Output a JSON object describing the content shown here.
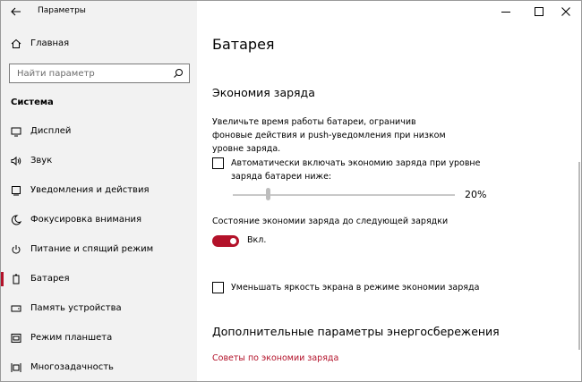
{
  "window": {
    "title": "Параметры"
  },
  "sidebar": {
    "home_label": "Главная",
    "search_placeholder": "Найти параметр",
    "section": "Система",
    "items": [
      {
        "label": "Дисплей",
        "icon": "monitor-icon"
      },
      {
        "label": "Звук",
        "icon": "speaker-icon"
      },
      {
        "label": "Уведомления и действия",
        "icon": "notification-icon"
      },
      {
        "label": "Фокусировка внимания",
        "icon": "moon-icon"
      },
      {
        "label": "Питание и спящий режим",
        "icon": "power-icon"
      },
      {
        "label": "Батарея",
        "icon": "battery-icon",
        "active": true
      },
      {
        "label": "Память устройства",
        "icon": "storage-icon"
      },
      {
        "label": "Режим планшета",
        "icon": "tablet-icon"
      },
      {
        "label": "Многозадачность",
        "icon": "multitask-icon"
      }
    ]
  },
  "main": {
    "title": "Батарея",
    "saver": {
      "heading": "Экономия заряда",
      "description": "Увеличьте время работы батареи, ограничив фоновые действия и push-уведомления при низком уровне заряда.",
      "auto_checkbox_label": "Автоматически включать экономию заряда при уровне заряда батареи ниже:",
      "auto_checked": false,
      "slider_value": "20%",
      "slider_fraction": 0.2,
      "state_label": "Состояние экономии заряда до следующей зарядки",
      "toggle_on": true,
      "toggle_label": "Вкл.",
      "brightness_checkbox_label": "Уменьшать яркость экрана в режиме экономии заряда",
      "brightness_checked": false
    },
    "extra": {
      "heading": "Дополнительные параметры энергосбережения",
      "link1": "Советы по экономии заряда"
    }
  },
  "colors": {
    "accent": "#b3122a",
    "sidebar_bg": "#f2f2f2"
  }
}
